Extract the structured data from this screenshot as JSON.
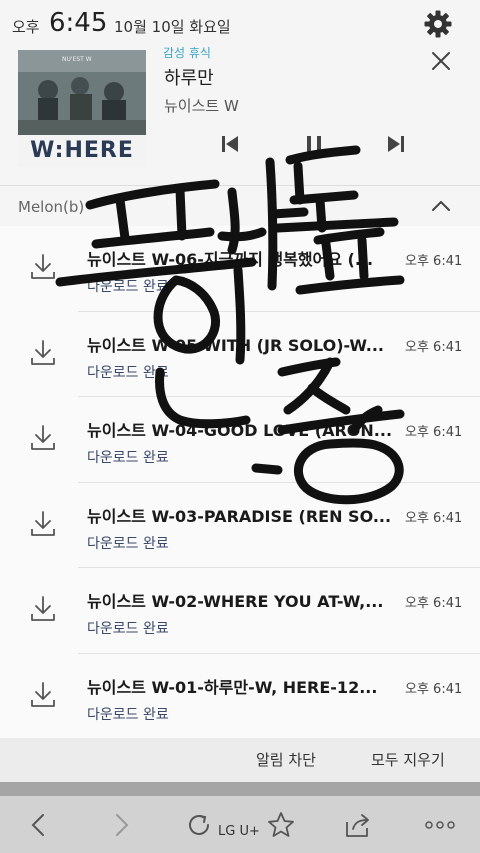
{
  "status_bar": {
    "ampm": "오후",
    "time": "6:45",
    "date": "10월 10일 화요일",
    "icons": [
      "gear-icon"
    ]
  },
  "now_playing": {
    "category": "감성 휴식",
    "song": "하루만",
    "artist": "뉴이스트 W",
    "album_art_text": "W:HERE",
    "album_art_small_text": "NU'EST W",
    "controls": [
      "skip-previous-icon",
      "pause-icon",
      "skip-next-icon"
    ]
  },
  "group": {
    "label": "Melon(b)"
  },
  "downloads": [
    {
      "title": "뉴이스트 W-06-지금까지 행복했어요 (...",
      "time": "오후 6:41",
      "status": "다운로드 완료"
    },
    {
      "title": "뉴이스트 W-05-WITH (JR SOLO)-W...",
      "time": "오후 6:41",
      "status": "다운로드 완료"
    },
    {
      "title": "뉴이스트 W-04-GOOD LOVE (ARON...",
      "time": "오후 6:41",
      "status": "다운로드 완료"
    },
    {
      "title": "뉴이스트 W-03-PARADISE (REN SO...",
      "time": "오후 6:41",
      "status": "다운로드 완료"
    },
    {
      "title": "뉴이스트 W-02-WHERE YOU AT-W,...",
      "time": "오후 6:41",
      "status": "다운로드 완료"
    },
    {
      "title": "뉴이스트 W-01-하루만-W, HERE-12...",
      "time": "오후 6:41",
      "status": "다운로드 완료"
    }
  ],
  "actions": {
    "block": "알림 차단",
    "clear_all": "모두 지우기"
  },
  "toolbar": {
    "carrier": "LG U+",
    "icons": [
      "back-icon",
      "forward-icon",
      "reload-icon",
      "star-icon",
      "share-icon",
      "more-icon"
    ]
  },
  "handwriting": "프사 투표 인증",
  "colors": {
    "background": "#f5f5f5",
    "category_accent": "#3aa6c6",
    "status_text": "#3a4a6a",
    "toolbar": "#d2d2d2"
  }
}
